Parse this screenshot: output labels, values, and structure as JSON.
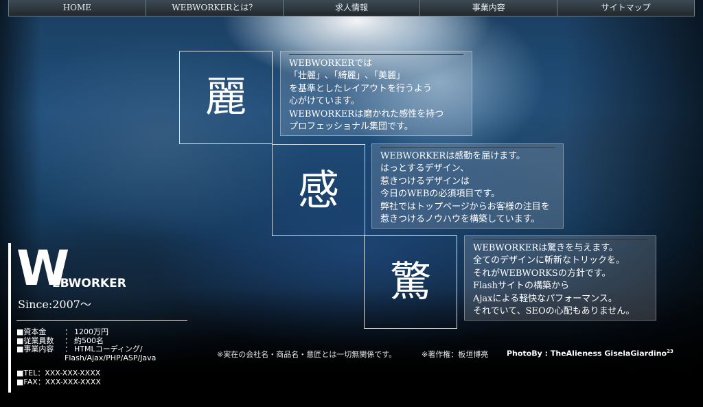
{
  "nav": {
    "items": [
      "HOME",
      "WEBWORKERとは？",
      "求人情報",
      "事業内容",
      "サイトマップ"
    ]
  },
  "kanji": [
    "麗",
    "感",
    "驚"
  ],
  "panels": [
    [
      "WEBWORKERでは",
      "「壮麗」､「綺麗」､「美麗」",
      "を基準としたレイアウトを行うよう",
      "心がけています。",
      "WEBWORKERは磨かれた感性を持つ",
      "プロフェッショナル集団です。"
    ],
    [
      "WEBWORKERは感動を届けます。",
      "はっとするデザイン、",
      "惹きつけるデザインは",
      "今日のWEBの必須項目です。",
      "弊社ではトップページからお客様の注目を",
      "惹きつけるノウハウを構築しています。"
    ],
    [
      "WEBWORKERは驚きを与えます。",
      "全てのデザインに斬新なトリックを。",
      "それがWEBWORKSの方針です。",
      "Flashサイトの構築から",
      "Ajaxによる軽快なパフォーマンス。",
      "それでいて、SEOの心配もありません。"
    ]
  ],
  "company": {
    "logo_w": "W",
    "logo_rest": "EBWORKER",
    "since": "Since:2007〜",
    "capital_key": "■資本金",
    "capital_value": "1200万円",
    "employees_key": "■従業員数",
    "employees_value": "約500名",
    "business_key": "■事業内容",
    "business_value_1": "HTMLコーディング/",
    "business_value_2": "Flash/Ajax/PHP/ASP/Java",
    "sep": "：",
    "tel": "■TEL：XXX-XXX-XXXX",
    "fax": "■FAX：XXX-XXX-XXXX"
  },
  "footer": {
    "notice": "※実在の会社名・商品名・意匠とは一切無関係です。",
    "copyright": "※著作権：板垣博亮",
    "photo": "PhotoBy : TheAlieness GiselaGiardino",
    "photo_sup": "23"
  }
}
